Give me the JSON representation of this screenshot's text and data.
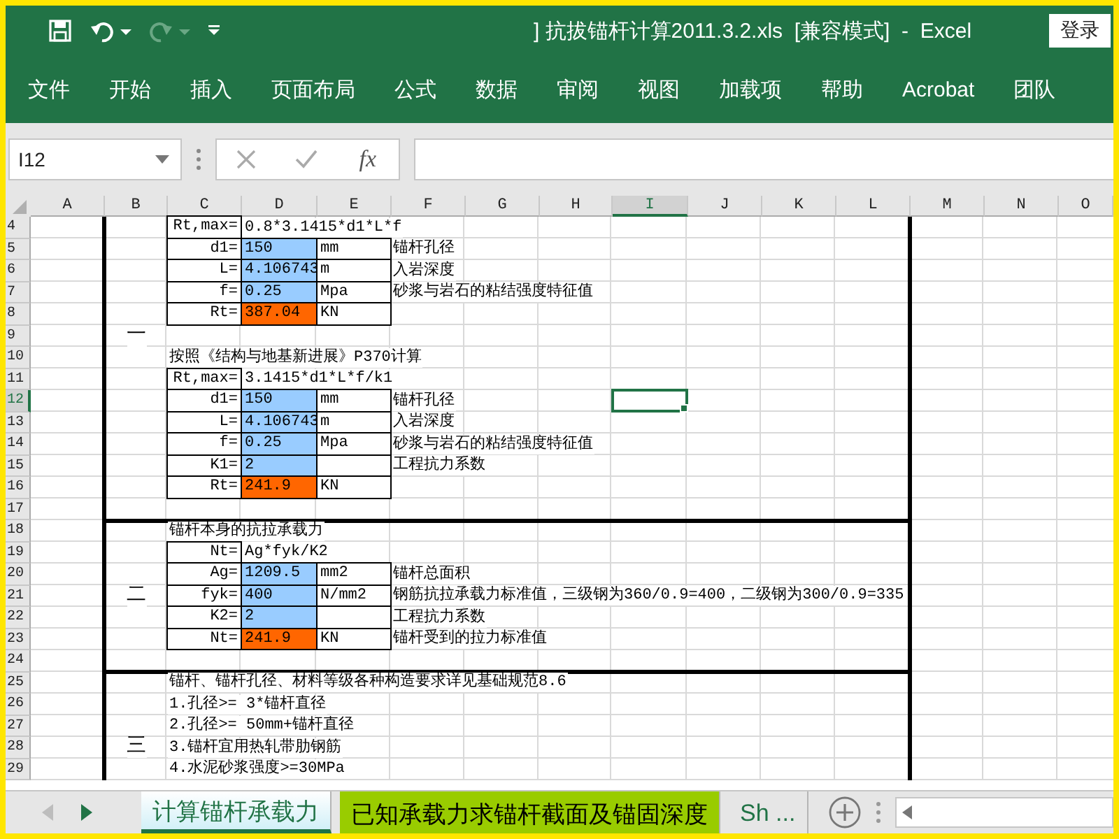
{
  "window": {
    "title": "] 抗拔锚杆计算2011.3.2.xls  [兼容模式]  -  Excel",
    "login_button": "登录"
  },
  "quick_access": [
    {
      "kind": "save",
      "disabled": false
    },
    {
      "kind": "undo",
      "disabled": false
    },
    {
      "kind": "redo",
      "disabled": true
    },
    {
      "kind": "customize",
      "disabled": false
    }
  ],
  "ribbon_tabs": [
    "文件",
    "开始",
    "插入",
    "页面布局",
    "公式",
    "数据",
    "审阅",
    "视图",
    "加载项",
    "帮助",
    "Acrobat",
    "团队"
  ],
  "formula_bar": {
    "name_box": "I12",
    "function_label": "fx"
  },
  "columns": [
    {
      "label": "A",
      "selected": false
    },
    {
      "label": "B",
      "selected": false
    },
    {
      "label": "C",
      "selected": false
    },
    {
      "label": "D",
      "selected": false
    },
    {
      "label": "E",
      "selected": false
    },
    {
      "label": "F",
      "selected": false
    },
    {
      "label": "G",
      "selected": false
    },
    {
      "label": "H",
      "selected": false
    },
    {
      "label": "I",
      "selected": true
    },
    {
      "label": "J",
      "selected": false
    },
    {
      "label": "K",
      "selected": false
    },
    {
      "label": "L",
      "selected": false
    },
    {
      "label": "M",
      "selected": false
    },
    {
      "label": "N",
      "selected": false
    },
    {
      "label": "O",
      "selected": false
    }
  ],
  "rows": [
    {
      "number": "4",
      "selected": false,
      "cells": {
        "C": {
          "kind": "label",
          "text": "Rt,max="
        },
        "D": {
          "kind": "formula",
          "text": "0.8*3.1415*d1*L*f"
        }
      }
    },
    {
      "number": "5",
      "selected": false,
      "cells": {
        "C": {
          "kind": "label",
          "text": "d1="
        },
        "D": {
          "kind": "input",
          "text": "150"
        },
        "E": {
          "kind": "unit",
          "text": "mm"
        },
        "F": {
          "kind": "note",
          "text": "锚杆孔径"
        }
      }
    },
    {
      "number": "6",
      "selected": false,
      "cells": {
        "C": {
          "kind": "label",
          "text": "L="
        },
        "D": {
          "kind": "input",
          "text": "4.106743"
        },
        "E": {
          "kind": "unit",
          "text": "m"
        },
        "F": {
          "kind": "note",
          "text": "入岩深度"
        }
      }
    },
    {
      "number": "7",
      "selected": false,
      "cells": {
        "C": {
          "kind": "label",
          "text": "f="
        },
        "D": {
          "kind": "input",
          "text": "0.25"
        },
        "E": {
          "kind": "unit",
          "text": "Mpa"
        },
        "F": {
          "kind": "note",
          "text": "砂浆与岩石的粘结强度特征值"
        }
      }
    },
    {
      "number": "8",
      "selected": false,
      "cells": {
        "C": {
          "kind": "label",
          "text": "Rt="
        },
        "D": {
          "kind": "result",
          "text": "387.04"
        },
        "E": {
          "kind": "unit",
          "text": "KN"
        }
      }
    },
    {
      "number": "9",
      "selected": false,
      "cells": {
        "B": {
          "kind": "section",
          "text": "一"
        }
      }
    },
    {
      "number": "10",
      "selected": false,
      "cells": {
        "C": {
          "kind": "note",
          "text": "按照《结构与地基新进展》P370计算"
        }
      }
    },
    {
      "number": "11",
      "selected": false,
      "cells": {
        "C": {
          "kind": "label",
          "text": "Rt,max="
        },
        "D": {
          "kind": "formula",
          "text": "3.1415*d1*L*f/k1"
        }
      }
    },
    {
      "number": "12",
      "selected": true,
      "cells": {
        "C": {
          "kind": "label",
          "text": "d1="
        },
        "D": {
          "kind": "input",
          "text": "150"
        },
        "E": {
          "kind": "unit",
          "text": "mm"
        },
        "F": {
          "kind": "note",
          "text": "锚杆孔径"
        }
      }
    },
    {
      "number": "13",
      "selected": false,
      "cells": {
        "C": {
          "kind": "label",
          "text": "L="
        },
        "D": {
          "kind": "input",
          "text": "4.106743"
        },
        "E": {
          "kind": "unit",
          "text": "m"
        },
        "F": {
          "kind": "note",
          "text": "入岩深度"
        }
      }
    },
    {
      "number": "14",
      "selected": false,
      "cells": {
        "C": {
          "kind": "label",
          "text": "f="
        },
        "D": {
          "kind": "input",
          "text": "0.25"
        },
        "E": {
          "kind": "unit",
          "text": "Mpa"
        },
        "F": {
          "kind": "note",
          "text": "砂浆与岩石的粘结强度特征值"
        }
      }
    },
    {
      "number": "15",
      "selected": false,
      "cells": {
        "C": {
          "kind": "label",
          "text": "K1="
        },
        "D": {
          "kind": "input",
          "text": "2"
        },
        "E": {
          "kind": "unit"
        },
        "F": {
          "kind": "note",
          "text": "工程抗力系数"
        }
      }
    },
    {
      "number": "16",
      "selected": false,
      "cells": {
        "C": {
          "kind": "label",
          "text": "Rt="
        },
        "D": {
          "kind": "result",
          "text": "241.9"
        },
        "E": {
          "kind": "unit",
          "text": "KN"
        }
      }
    },
    {
      "number": "17",
      "selected": false,
      "cells": {}
    },
    {
      "number": "18",
      "selected": false,
      "cells": {
        "C": {
          "kind": "note",
          "text": "锚杆本身的抗拉承载力"
        }
      }
    },
    {
      "number": "19",
      "selected": false,
      "cells": {
        "C": {
          "kind": "label",
          "text": "Nt="
        },
        "D": {
          "kind": "formula",
          "text": "Ag*fyk/K2"
        }
      }
    },
    {
      "number": "20",
      "selected": false,
      "cells": {
        "C": {
          "kind": "label",
          "text": "Ag="
        },
        "D": {
          "kind": "input",
          "text": "1209.5"
        },
        "E": {
          "kind": "unit",
          "text": "mm2"
        },
        "F": {
          "kind": "note",
          "text": "锚杆总面积"
        }
      }
    },
    {
      "number": "21",
      "selected": false,
      "cells": {
        "B": {
          "kind": "section",
          "text": "二"
        },
        "C": {
          "kind": "label",
          "text": "fyk="
        },
        "D": {
          "kind": "input",
          "text": "400"
        },
        "E": {
          "kind": "unit",
          "text": "N/mm2"
        },
        "F": {
          "kind": "note",
          "text": "钢筋抗拉承载力标准值，三级钢为360/0.9=400，二级钢为300/0.9=335"
        }
      }
    },
    {
      "number": "22",
      "selected": false,
      "cells": {
        "C": {
          "kind": "label",
          "text": "K2="
        },
        "D": {
          "kind": "input",
          "text": "2"
        },
        "E": {
          "kind": "unit"
        },
        "F": {
          "kind": "note",
          "text": "工程抗力系数"
        }
      }
    },
    {
      "number": "23",
      "selected": false,
      "cells": {
        "C": {
          "kind": "label",
          "text": "Nt="
        },
        "D": {
          "kind": "result",
          "text": "241.9"
        },
        "E": {
          "kind": "unit",
          "text": "KN"
        },
        "F": {
          "kind": "note",
          "text": "锚杆受到的拉力标准值"
        }
      }
    },
    {
      "number": "24",
      "selected": false,
      "cells": {}
    },
    {
      "number": "25",
      "selected": false,
      "cells": {
        "C": {
          "kind": "note",
          "text": "锚杆、锚杆孔径、材料等级各种构造要求详见基础规范8.6"
        }
      }
    },
    {
      "number": "26",
      "selected": false,
      "cells": {
        "C": {
          "kind": "note",
          "text": "1.孔径>= 3*锚杆直径"
        }
      }
    },
    {
      "number": "27",
      "selected": false,
      "cells": {
        "C": {
          "kind": "note",
          "text": "2.孔径>= 50mm+锚杆直径"
        }
      }
    },
    {
      "number": "28",
      "selected": false,
      "cells": {
        "B": {
          "kind": "section",
          "text": "三"
        },
        "C": {
          "kind": "note",
          "text": "3.锚杆宜用热轧带肋钢筋"
        }
      }
    },
    {
      "number": "29",
      "selected": false,
      "cells": {
        "C": {
          "kind": "note",
          "text": "4.水泥砂浆强度>=30MPa"
        }
      }
    }
  ],
  "sheet_nav": [
    {
      "kind": "prev",
      "disabled": true
    },
    {
      "kind": "next",
      "disabled": false
    }
  ],
  "sheet_tabs": [
    {
      "label": "计算锚杆承载力",
      "selected": true,
      "color": "#d2f0f8"
    },
    {
      "label": "已知承载力求锚杆截面及锚固深度",
      "selected": false,
      "color": "#99cc00"
    },
    {
      "label": "Sh ...",
      "selected": false
    }
  ]
}
